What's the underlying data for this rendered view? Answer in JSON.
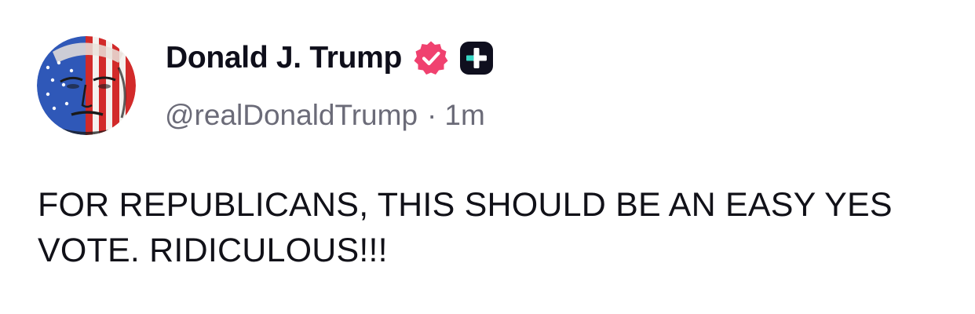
{
  "post": {
    "author": {
      "display_name": "Donald J. Trump",
      "handle": "@realDonaldTrump",
      "verified_icon": "verified-badge-icon",
      "badge_icon": "plus-badge-icon",
      "avatar": "avatar-image"
    },
    "separator": "·",
    "timestamp": "1m",
    "text": "FOR REPUBLICANS, THIS SHOULD BE AN EASY YES VOTE. RIDICULOUS!!!"
  },
  "colors": {
    "verified_badge": "#f0416f",
    "plus_badge_bg": "#0f0f1e",
    "plus_badge_accent": "#36d6c4",
    "secondary_text": "#6b6b78",
    "primary_text": "#0e0e1a"
  }
}
